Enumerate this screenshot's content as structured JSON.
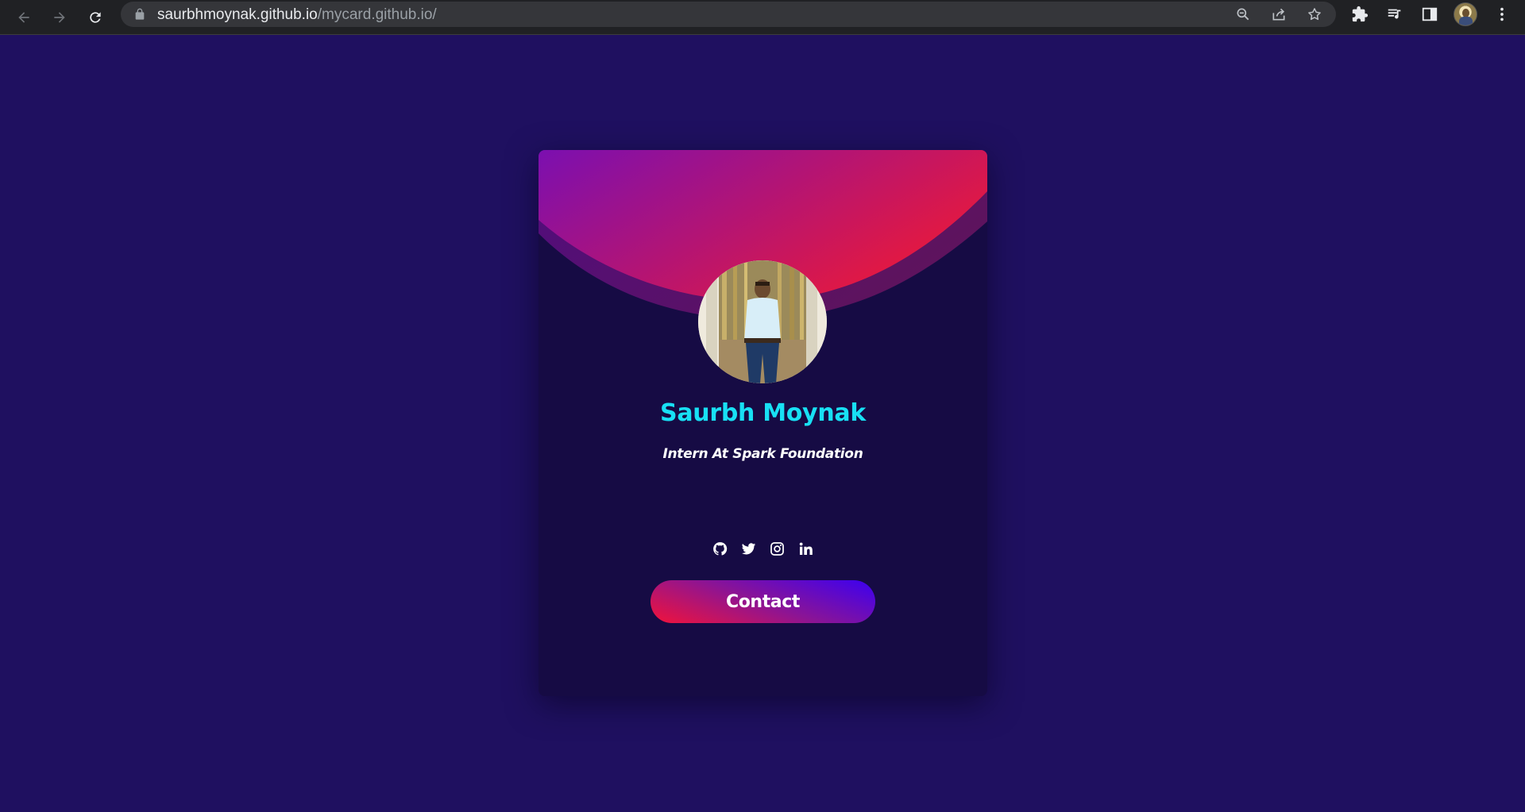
{
  "browser": {
    "url_host": "saurbhmoynak.github.io",
    "url_path": "/mycard.github.io/",
    "icons": [
      "back-icon",
      "forward-icon",
      "reload-icon",
      "lock-icon",
      "zoom-icon",
      "share-icon",
      "bookmark-star-icon",
      "extensions-icon",
      "media-queue-icon",
      "side-panel-icon",
      "profile-avatar",
      "menu-kebab-icon"
    ]
  },
  "theme": {
    "page_background": "#1f1060",
    "card_background": "#160b44",
    "header_gradient_start": "#7b0fb0",
    "header_gradient_end": "#e8193c",
    "name_color": "#18e0f4",
    "button_gradient": [
      "#3b00f2",
      "#8a1496",
      "#f2133a"
    ]
  },
  "card": {
    "name": "Saurbh Moynak",
    "role": "Intern At Spark Foundation",
    "socials": [
      {
        "icon": "github-icon"
      },
      {
        "icon": "twitter-icon"
      },
      {
        "icon": "instagram-icon"
      },
      {
        "icon": "linkedin-icon"
      }
    ],
    "contact_label": "Contact"
  }
}
